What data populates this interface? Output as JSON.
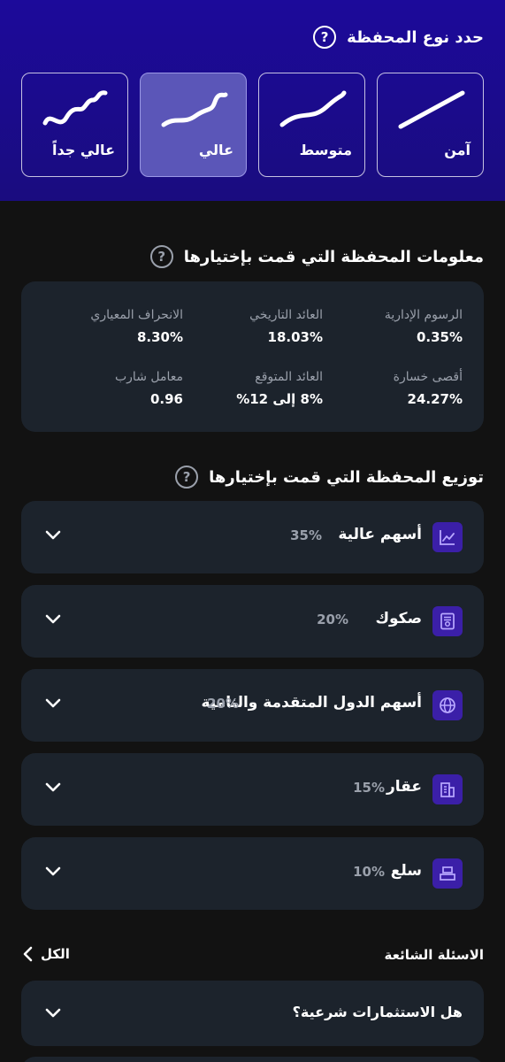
{
  "portfolio_type": {
    "title": "حدد نوع المحفظة",
    "options": [
      {
        "label": "آمن",
        "selected": false
      },
      {
        "label": "متوسط",
        "selected": false
      },
      {
        "label": "عالي",
        "selected": true
      },
      {
        "label": "عالي جداً",
        "selected": false
      }
    ]
  },
  "info": {
    "title": "معلومات المحفظة التي قمت بإختيارها",
    "metrics": [
      {
        "label": "الرسوم الإدارية",
        "value": "0.35%"
      },
      {
        "label": "العائد التاريخي",
        "value": "18.03%"
      },
      {
        "label": "الانحراف المعياري",
        "value": "8.30%"
      },
      {
        "label": "أقصى خسارة",
        "value": "24.27%"
      },
      {
        "label": "العائد المتوقع",
        "value": "8% إلى 12%"
      },
      {
        "label": "معامل شارب",
        "value": "0.96"
      }
    ]
  },
  "allocation": {
    "title": "توزيع المحفظة التي قمت بإختيارها",
    "items": [
      {
        "name": "أسهم عالية",
        "percent": "35%",
        "icon": "chart-line-icon"
      },
      {
        "name": "صكوك",
        "percent": "20%",
        "icon": "certificate-icon"
      },
      {
        "name": "أسهم الدول المتقدمة والنامية",
        "percent": "20%",
        "icon": "globe-icon"
      },
      {
        "name": "عقار",
        "percent": "15%",
        "icon": "building-icon"
      },
      {
        "name": "سلع",
        "percent": "10%",
        "icon": "gold-bars-icon"
      }
    ]
  },
  "faq": {
    "title": "الاسئلة الشائعة",
    "all_label": "الكل",
    "items": [
      {
        "question": "هل الاستثمارات شرعية؟"
      }
    ]
  },
  "colors": {
    "header_bg": "#1c0a9a",
    "card_bg": "#1c232c",
    "accent": "#3b1fa8",
    "selected_card": "#5b56b8",
    "muted_text": "#9aa0ab"
  }
}
